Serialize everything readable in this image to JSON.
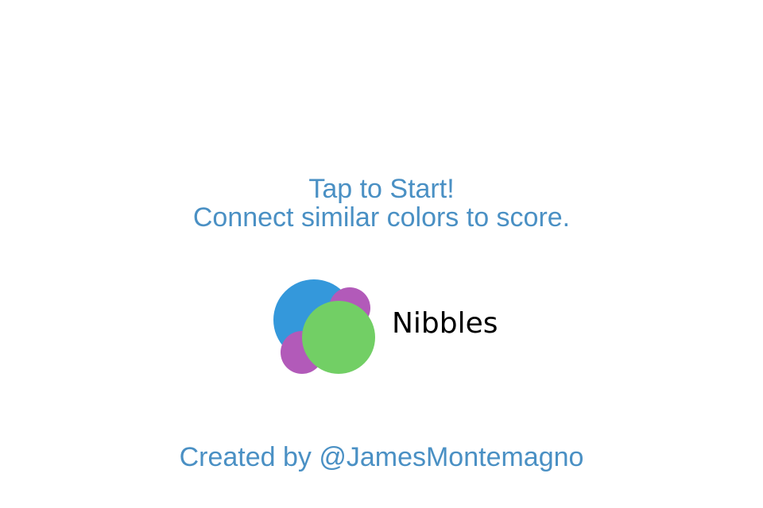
{
  "start_prompt": "Tap to Start!",
  "instructions": "Connect similar colors to score.",
  "logo": {
    "app_name": "Nibbles",
    "icon_name": "nibbles-bubbles-logo-icon",
    "colors": {
      "blue": "#3498db",
      "purple": "#b25ab9",
      "green": "#72cf65"
    }
  },
  "credits": "Created by @JamesMontemagno",
  "colors": {
    "text_accent": "#4a90c4",
    "background": "#ffffff",
    "app_name_text": "#000000"
  }
}
